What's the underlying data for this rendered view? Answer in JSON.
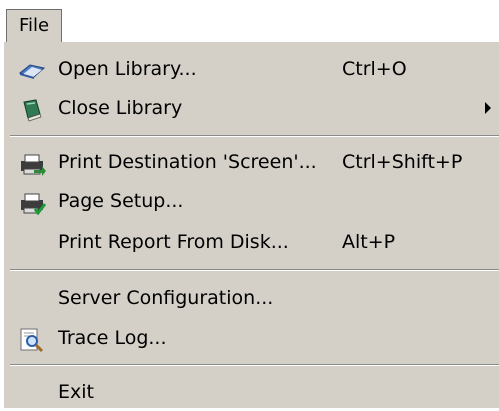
{
  "menubar": {
    "file_label": "File"
  },
  "menu": {
    "open_library": {
      "label": "Open Library...",
      "shortcut": "Ctrl+O"
    },
    "close_library": {
      "label": "Close Library"
    },
    "print_destination": {
      "label": "Print Destination 'Screen'...",
      "shortcut": "Ctrl+Shift+P"
    },
    "page_setup": {
      "label": "Page Setup..."
    },
    "print_report": {
      "label": "Print Report From Disk...",
      "shortcut": "Alt+P"
    },
    "server_configuration": {
      "label": "Server Configuration..."
    },
    "trace_log": {
      "label": "Trace Log..."
    },
    "exit": {
      "label": "Exit"
    }
  },
  "icons": {
    "open_library": "open-book-icon",
    "close_library": "closed-book-icon",
    "print_destination": "printer-arrow-icon",
    "page_setup": "printer-check-icon",
    "trace_log": "magnifier-document-icon",
    "submenu_arrow": "chevron-right-icon"
  }
}
